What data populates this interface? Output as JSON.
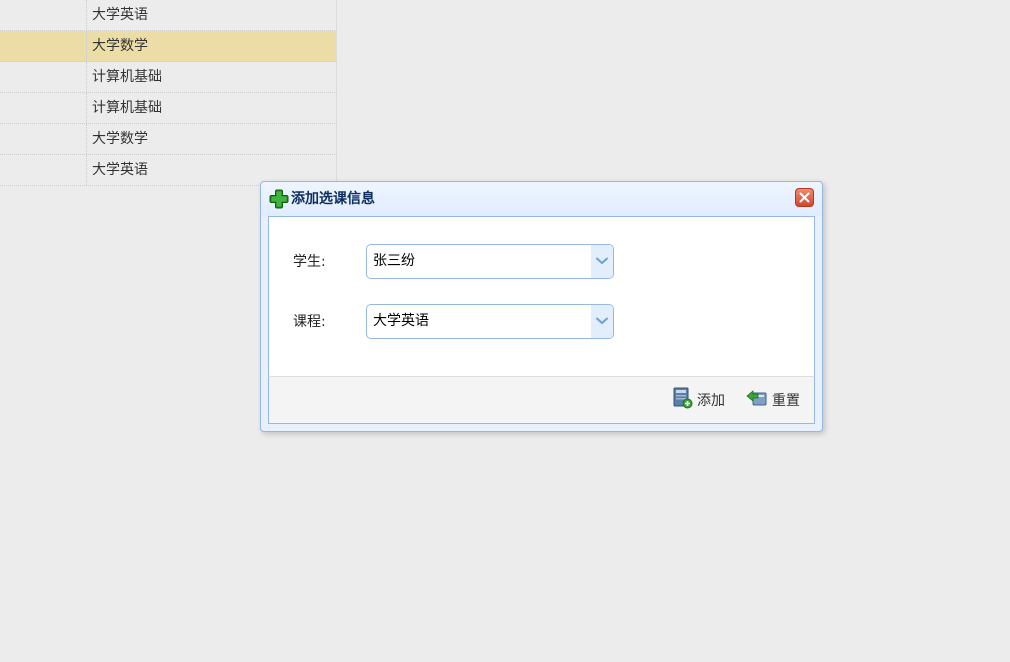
{
  "grid": {
    "rows": [
      {
        "course": "大学英语",
        "selected": false
      },
      {
        "course": "大学数学",
        "selected": true
      },
      {
        "course": "计算机基础",
        "selected": false
      },
      {
        "course": "计算机基础",
        "selected": false
      },
      {
        "course": "大学数学",
        "selected": false
      },
      {
        "course": "大学英语",
        "selected": false
      }
    ]
  },
  "dialog": {
    "title": "添加选课信息",
    "fields": {
      "student": {
        "label": "学生:",
        "value": "张三纷"
      },
      "course": {
        "label": "课程:",
        "value": "大学英语"
      }
    },
    "buttons": {
      "add": "添加",
      "reset": "重置"
    }
  },
  "colors": {
    "selected_row": "#ecdca6",
    "panel_border": "#95b8e7",
    "title_text": "#0e2d5f",
    "close_button": "#d6462a"
  }
}
